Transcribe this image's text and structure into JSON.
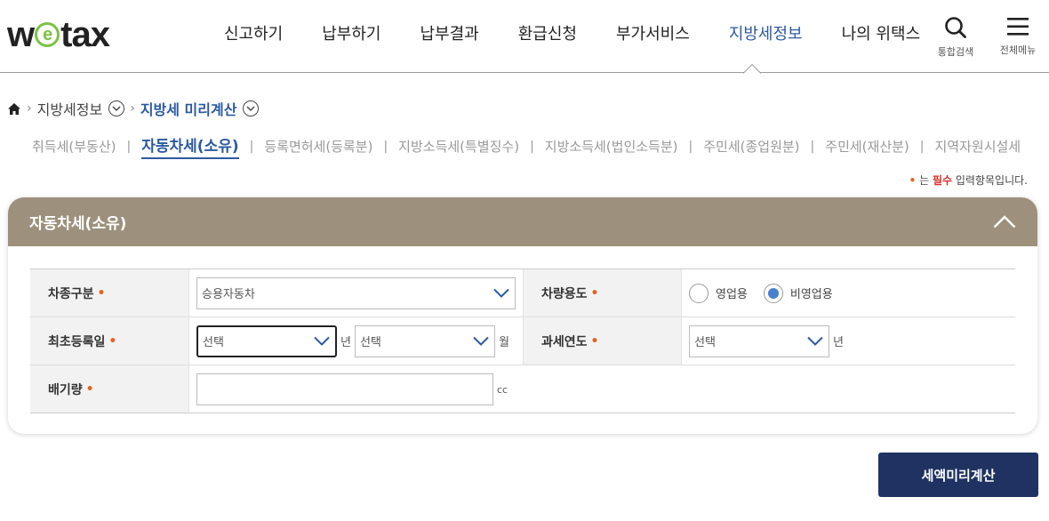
{
  "logo": {
    "prefix": "w",
    "e": "e",
    "suffix": "tax"
  },
  "nav": {
    "items": [
      "신고하기",
      "납부하기",
      "납부결과",
      "환급신청",
      "부가서비스",
      "지방세정보",
      "나의 위택스"
    ],
    "active": "지방세정보"
  },
  "utils": {
    "search_label": "통합검색",
    "menu_label": "전체메뉴"
  },
  "breadcrumb": {
    "level1": "지방세정보",
    "level2": "지방세 미리계산"
  },
  "tabs": [
    "취득세(부동산)",
    "자동차세(소유)",
    "등록면허세(등록분)",
    "지방소득세(특별징수)",
    "지방소득세(법인소득분)",
    "주민세(종업원분)",
    "주민세(재산분)",
    "지역자원시설세"
  ],
  "active_tab": "자동차세(소유)",
  "required_note": {
    "dot": "•",
    "prefix": "는 ",
    "highlight": "필수",
    "suffix": " 입력항목입니다."
  },
  "panel": {
    "title": "자동차세(소유)",
    "fields": {
      "vehicle_type": {
        "label": "차종구분",
        "value": "승용자동차"
      },
      "vehicle_use": {
        "label": "차량용도",
        "options": [
          "영업용",
          "비영업용"
        ],
        "selected": "비영업용"
      },
      "first_reg": {
        "label": "최초등록일",
        "year_value": "선택",
        "year_unit": "년",
        "month_value": "선택",
        "month_unit": "월"
      },
      "tax_year": {
        "label": "과세연도",
        "value": "선택",
        "unit": "년"
      },
      "displacement": {
        "label": "배기량",
        "value": "",
        "unit": "cc"
      }
    },
    "required_mark": "•"
  },
  "calc_button": "세액미리계산",
  "colors": {
    "accent": "#2c5aa0",
    "panel_header": "#9d917d",
    "button": "#1f3261",
    "required": "#e8621c",
    "logo_e": "#7cc243"
  }
}
